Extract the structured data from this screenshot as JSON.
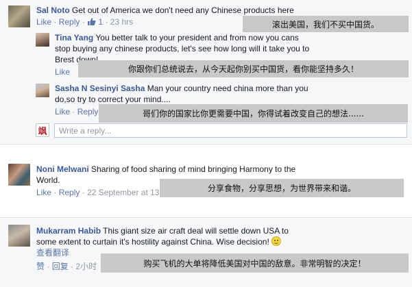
{
  "comments": [
    {
      "name": "Sal Noto",
      "text": "Get out of America we don't need any Chinese products here",
      "actions": {
        "like": "Like",
        "reply": "Reply",
        "like_count": "1",
        "time": "23 hrs"
      },
      "translation": "滚出美国，我们不买中国货。",
      "replies": [
        {
          "name": "Tina Yang",
          "line1": "You better talk to your president and from now you cans",
          "line2": "stop buying any chinese products, let's see how long will it take you to",
          "line3": "Brest down!",
          "actions": {
            "like": "Like"
          },
          "translation": "你跟你们总统说去，从今天起你别买中国货，看你能坚持多久！"
        },
        {
          "name": "Sasha N Sesinyi Sasha",
          "line1": "Man your country need china more than you",
          "line2": "do,so try to correct your mind....",
          "actions": {
            "like": "Like",
            "reply": "Reply"
          },
          "translation": "哥们你的国家比你更需要中国，你得试着改变自己的想法......"
        }
      ],
      "reply_placeholder": "Write a reply...",
      "self_avatar_char": "飒"
    },
    {
      "name": "Noni Melwani",
      "line1": "Sharing of food sharing of mind bringing Harmony to the",
      "line2": "World.",
      "actions": {
        "like": "Like",
        "reply": "Reply",
        "time": "22 September at 13"
      },
      "translation": "分享食物，分享思想，为世界带来和谐。"
    },
    {
      "name": "Mukarram Habib",
      "line1": "This giant size air craft deal will settle down USA to",
      "line2": "some extent to curtain it's hostility against China. Wise decision!",
      "see_translation": "查看翻译",
      "actions": {
        "like": "赞",
        "reply": "回复",
        "time": "2小时"
      },
      "translation": "购买飞机的大单将降低美国对中国的敌意。非常明智的决定！"
    }
  ],
  "colors": {
    "name_blue": "#3b5998",
    "link_blue": "#5b74a8",
    "meta_gray": "#9197a3",
    "panel_gray": "#f6f7f9",
    "overlay_gray": "#c8c8c8"
  }
}
